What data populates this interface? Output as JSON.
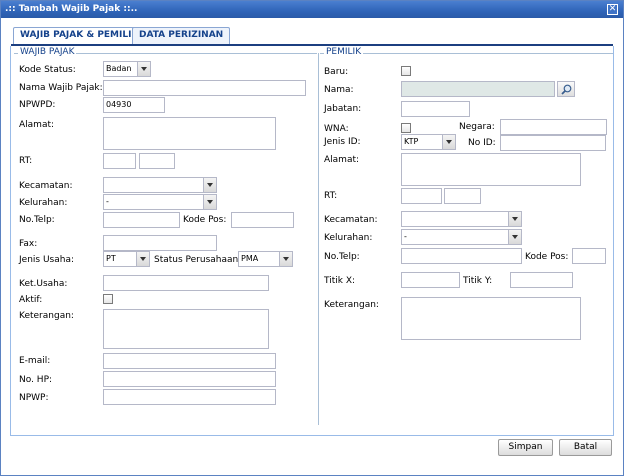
{
  "window": {
    "title": ".:: Tambah Wajib Pajak ::..",
    "close_glyph": "✕"
  },
  "tabs": [
    {
      "label": "WAJIB PAJAK & PEMILIK",
      "active": true
    },
    {
      "label": "DATA PERIZINAN",
      "active": false
    }
  ],
  "wajib_pajak": {
    "legend": "WAJIB PAJAK",
    "kode_status_label": "Kode Status:",
    "kode_status_value": "Badan",
    "nama_label": "Nama Wajib Pajak:",
    "nama_value": "",
    "npwpd_label": "NPWPD:",
    "npwpd_value": "04930",
    "alamat_label": "Alamat:",
    "rt_label": "RT:",
    "kecamatan_label": "Kecamatan:",
    "kecamatan_value": "",
    "kelurahan_label": "Kelurahan:",
    "kelurahan_value": "-",
    "telp_label": "No.Telp:",
    "kodepos_label": "Kode Pos:",
    "fax_label": "Fax:",
    "jenis_usaha_label": "Jenis Usaha:",
    "jenis_usaha_value": "PT",
    "status_perusahaan_label": "Status Perusahaan:",
    "status_perusahaan_value": "PMA",
    "ket_usaha_label": "Ket.Usaha:",
    "aktif_label": "Aktif:",
    "keterangan_label": "Keterangan:",
    "email_label": "E-mail:",
    "hp_label": "No. HP:",
    "npwp_label": "NPWP:"
  },
  "pemilik": {
    "legend": "PEMILIK",
    "baru_label": "Baru:",
    "nama_label": "Nama:",
    "jabatan_label": "Jabatan:",
    "wna_label": "WNA:",
    "negara_label": "Negara:",
    "jenis_id_label": "Jenis ID:",
    "jenis_id_value": "KTP",
    "no_id_label": "No ID:",
    "alamat_label": "Alamat:",
    "rt_label": "RT:",
    "kecamatan_label": "Kecamatan:",
    "kecamatan_value": "",
    "kelurahan_label": "Kelurahan:",
    "kelurahan_value": "-",
    "telp_label": "No.Telp:",
    "kodepos_label": "Kode Pos:",
    "titik_x_label": "Titik X:",
    "titik_y_label": "Titik Y:",
    "keterangan_label": "Keterangan:"
  },
  "buttons": {
    "save": "Simpan",
    "cancel": "Batal"
  }
}
